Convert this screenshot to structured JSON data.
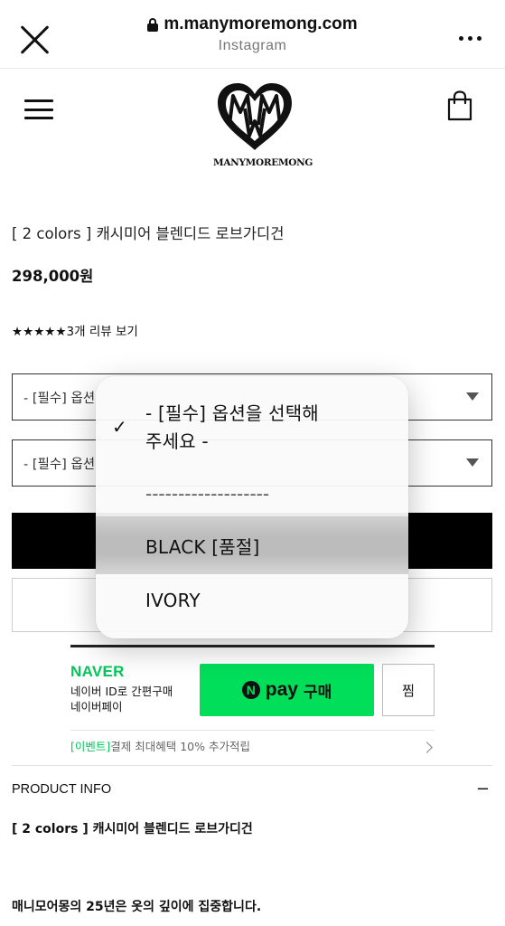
{
  "browser": {
    "url": "m.manymoremong.com",
    "source": "Instagram"
  },
  "site": {
    "logo_text": "MANYMOREMONG"
  },
  "product": {
    "title": "[ 2 colors ] 캐시미어 블렌디드 로브가디건",
    "price": "298,000원",
    "review_text": "★★★★★3개 리뷰 보기",
    "select_1": "- [필수] 옵션",
    "select_2": "- [필수] 옵션"
  },
  "naver_pay": {
    "brand": "NAVER",
    "desc_line1": "네이버 ID로 간편구매",
    "desc_line2": "네이버페이",
    "button_pay": "pay",
    "button_buy": "구매",
    "wish_label": "찜",
    "event_tag": "[이벤트]",
    "event_text": "결제 최대혜택 10% 추가적립"
  },
  "product_info": {
    "heading": "PRODUCT INFO",
    "toggle": "−",
    "title": "[ 2 colors ] 캐시미어 블렌디드 로브가디건",
    "body_line": "매니모어몽의 25년은 옷의 깊이에 집중합니다."
  },
  "dropdown": {
    "check": "✓",
    "option_selected_line1": "- [필수] 옵션을 선택해",
    "option_selected_line2": "주세요 -",
    "separator": "-------------------",
    "option_black": "BLACK [품절]",
    "option_ivory": "IVORY"
  },
  "colors": {
    "naver_green": "#03c75a",
    "npay_button": "#00de5a"
  }
}
